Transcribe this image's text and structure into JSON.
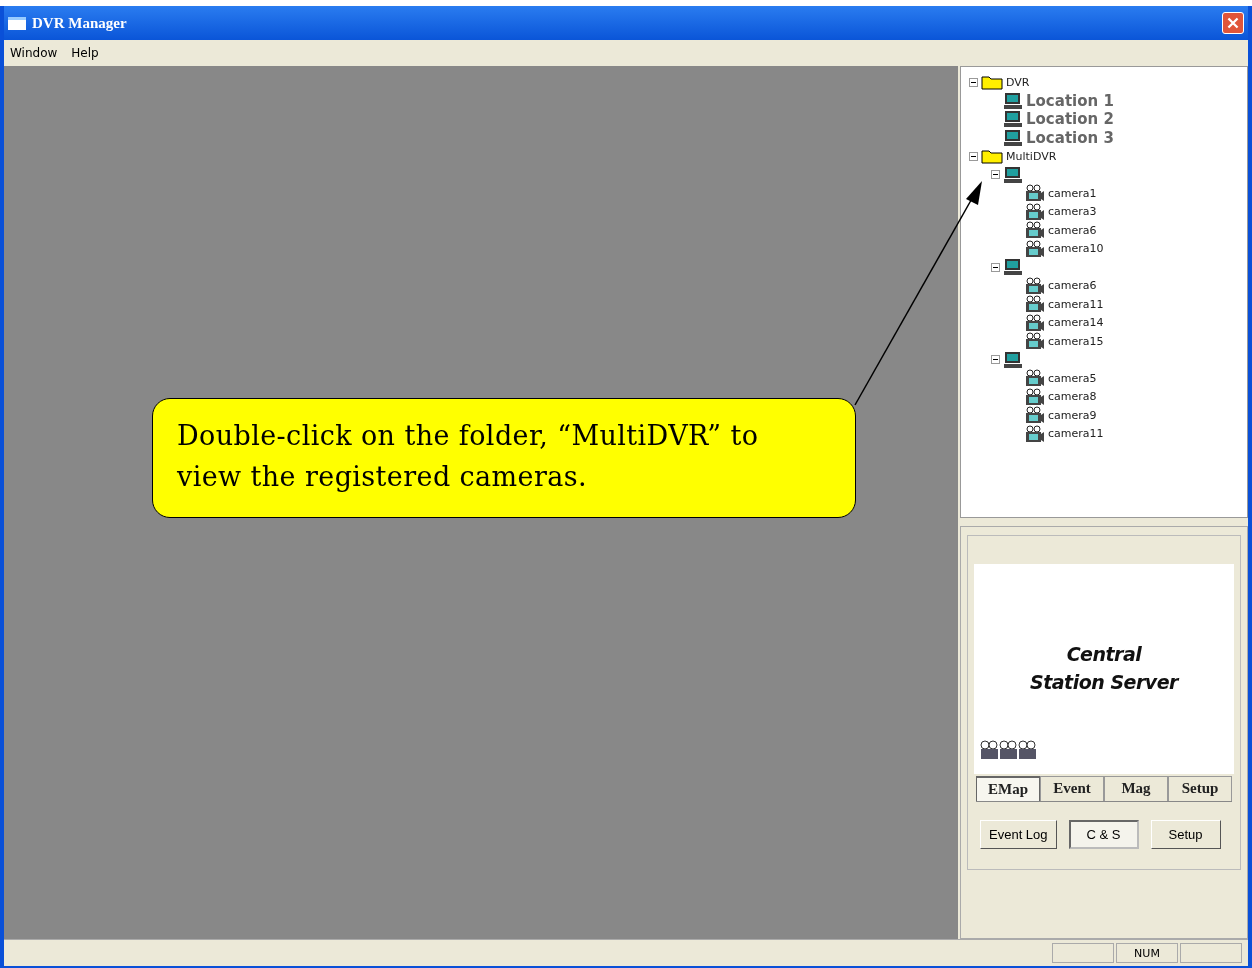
{
  "window": {
    "title": "DVR Manager"
  },
  "menu": [
    "Window",
    "Help"
  ],
  "tree": [
    {
      "kind": "folder",
      "label": "DVR",
      "expanded": true,
      "children": [
        {
          "kind": "location",
          "label": "Location 1"
        },
        {
          "kind": "location",
          "label": "Location 2"
        },
        {
          "kind": "location",
          "label": "Location 3"
        }
      ]
    },
    {
      "kind": "folder",
      "label": "MultiDVR",
      "expanded": true,
      "children": [
        {
          "kind": "dvr",
          "expanded": true,
          "children": [
            {
              "kind": "camera",
              "label": "camera1"
            },
            {
              "kind": "camera",
              "label": "camera3"
            },
            {
              "kind": "camera",
              "label": "camera6"
            },
            {
              "kind": "camera",
              "label": "camera10"
            }
          ]
        },
        {
          "kind": "dvr",
          "expanded": true,
          "children": [
            {
              "kind": "camera",
              "label": "camera6"
            },
            {
              "kind": "camera",
              "label": "camera11"
            },
            {
              "kind": "camera",
              "label": "camera14"
            },
            {
              "kind": "camera",
              "label": "camera15"
            }
          ]
        },
        {
          "kind": "dvr",
          "expanded": true,
          "children": [
            {
              "kind": "camera",
              "label": "camera5"
            },
            {
              "kind": "camera",
              "label": "camera8"
            },
            {
              "kind": "camera",
              "label": "camera9"
            },
            {
              "kind": "camera",
              "label": "camera11"
            }
          ]
        }
      ]
    }
  ],
  "server_panel": {
    "title_lines": [
      "Central",
      "Station Server"
    ]
  },
  "tabs": [
    {
      "label": "EMap",
      "selected": true
    },
    {
      "label": "Event",
      "selected": false
    },
    {
      "label": "Mag",
      "selected": false
    },
    {
      "label": "Setup",
      "selected": false
    }
  ],
  "buttons": [
    {
      "label": "Event Log",
      "selected": false
    },
    {
      "label": "C & S",
      "selected": true
    },
    {
      "label": "Setup",
      "selected": false
    }
  ],
  "status_bar": {
    "indicator": "NUM"
  },
  "callout": {
    "text": "Double-click on the folder, “MultiDVR” to view the registered cameras."
  }
}
